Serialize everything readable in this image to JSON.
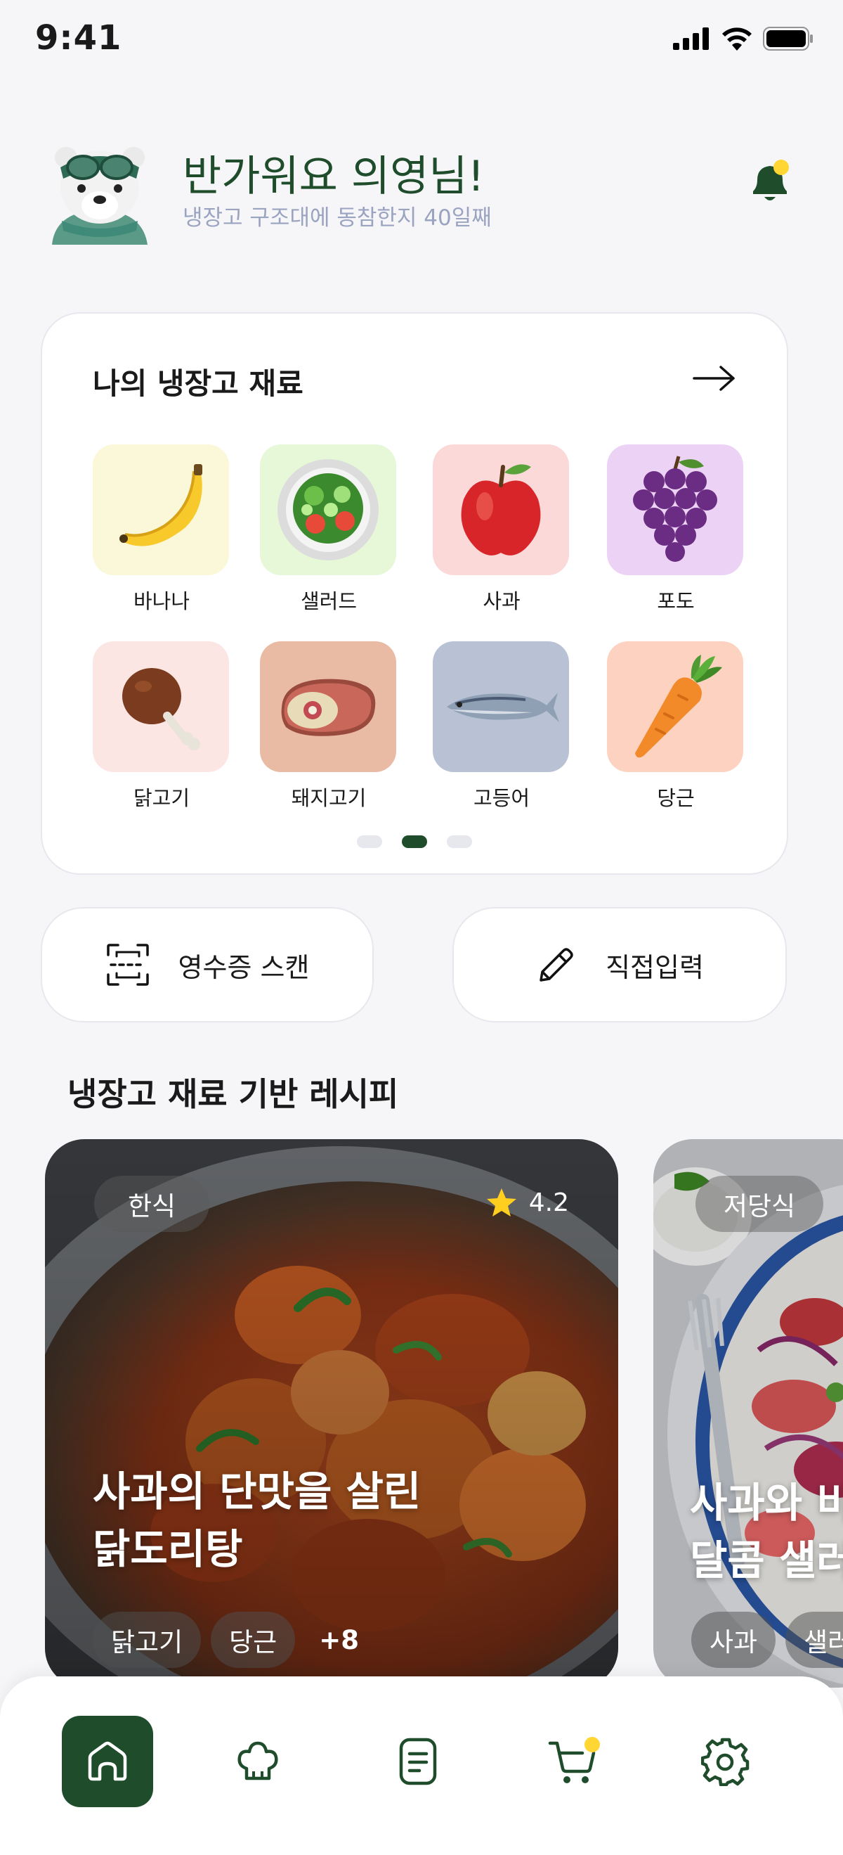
{
  "status_bar": {
    "time": "9:41"
  },
  "greeting": {
    "title": "반가워요 의영님!",
    "subtitle": "냉장고 구조대에 동참한지 40일째"
  },
  "fridge": {
    "title": "나의 냉장고 재료",
    "items": [
      {
        "label": "바나나",
        "icon": "banana-icon",
        "bg": "#faf8d8"
      },
      {
        "label": "샐러드",
        "icon": "salad-icon",
        "bg": "#e6f8d8"
      },
      {
        "label": "사과",
        "icon": "apple-icon",
        "bg": "#fbd9d9"
      },
      {
        "label": "포도",
        "icon": "grape-icon",
        "bg": "#ecd3f5"
      },
      {
        "label": "닭고기",
        "icon": "chicken-leg-icon",
        "bg": "#fbe6e4"
      },
      {
        "label": "돼지고기",
        "icon": "pork-icon",
        "bg": "#e9bba5"
      },
      {
        "label": "고등어",
        "icon": "mackerel-icon",
        "bg": "#b8c2d4"
      },
      {
        "label": "당근",
        "icon": "carrot-icon",
        "bg": "#fdd2c0"
      }
    ],
    "page_count": 3,
    "active_page": 2
  },
  "actions": {
    "scan_label": "영수증 스캔",
    "manual_label": "직접입력"
  },
  "recipes": {
    "section_title": "냉장고 재료 기반 레시피",
    "cards": [
      {
        "category": "한식",
        "rating": "4.2",
        "title_line1": "사과의 단맛을 살린",
        "title_line2": "닭도리탕",
        "tags": [
          "닭고기",
          "당근"
        ],
        "more": "+8"
      },
      {
        "category": "저당식",
        "title_line1": "사과와 비",
        "title_line2": "달콤 샐러",
        "tags": [
          "사과",
          "샐러"
        ]
      }
    ]
  },
  "nav": {
    "items": [
      {
        "name": "home",
        "active": true
      },
      {
        "name": "chef-hat",
        "active": false
      },
      {
        "name": "document",
        "active": false
      },
      {
        "name": "cart",
        "active": false
      },
      {
        "name": "settings",
        "active": false
      }
    ]
  },
  "colors": {
    "accent": "#1f4d2c",
    "notification": "#ffd633",
    "subtitle": "#9aa3bf"
  }
}
